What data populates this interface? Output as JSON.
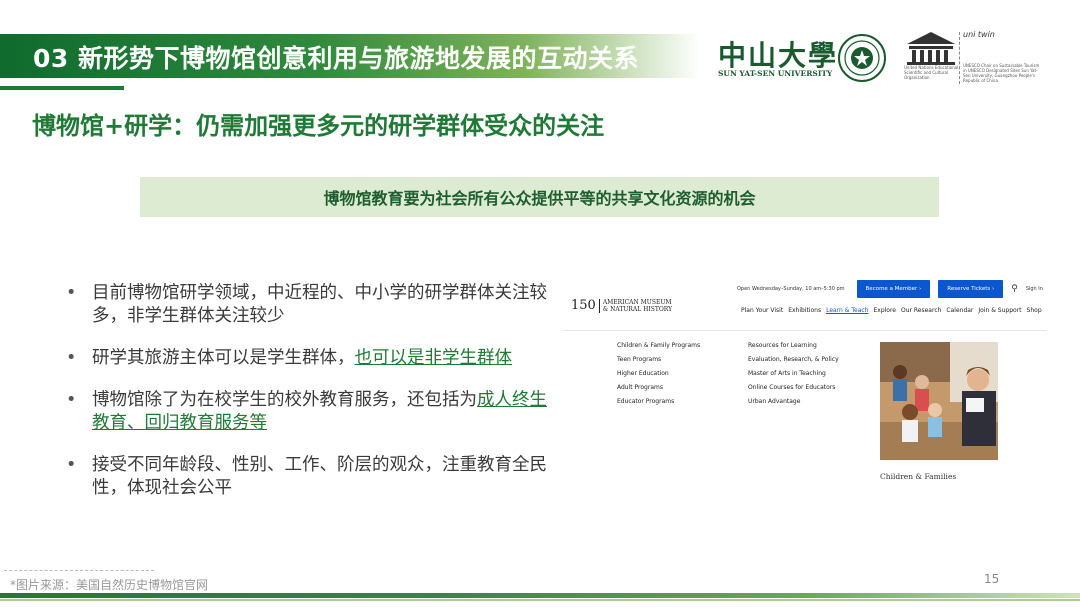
{
  "header": {
    "title": "03 新形势下博物馆创意利用与旅游地发展的互动关系"
  },
  "logos": {
    "sysu_cn": "中山大學",
    "sysu_en": "SUN YAT-SEN UNIVERSITY",
    "unesco_text": "United Nations Educational, Scientific and Cultural Organization",
    "unitwin_label": "uni twin",
    "unitwin_text": "UNESCO Chair on Sustainable Tourism in UNESCO Designated Sites Sun Yat-Sen University, Guangzhou People's Republic of China"
  },
  "subtitle": "博物馆+研学：仍需加强更多元的研学群体受众的关注",
  "banner": "博物馆教育要为社会所有公众提供平等的共享文化资源的机会",
  "bullets": [
    {
      "text": "目前博物馆研学领域，中近程的、中小学的研学群体关注较多，非学生群体关注较少",
      "highlight": ""
    },
    {
      "text": "研学其旅游主体可以是学生群体，",
      "highlight": "也可以是非学生群体"
    },
    {
      "text": "博物馆除了为在校学生的校外教育服务，还包括为",
      "highlight": "成人终生教育、回归教育服务等"
    },
    {
      "text": "接受不同年龄段、性别、工作、阶层的观众，注重教育全民性，体现社会公平",
      "highlight": ""
    }
  ],
  "site": {
    "hours": "Open Wednesday–Sunday, 10 am–5:30 pm",
    "member_button": "Become a Member ›",
    "tickets_button": "Reserve Tickets ›",
    "search_icon": "search-icon",
    "signin": "Sign In",
    "logo_150": "150",
    "museum_line1": "AMERICAN MUSEUM",
    "museum_line2": "& NATURAL HISTORY",
    "nav": [
      "Plan Your Visit",
      "Exhibitions",
      "Learn & Teach",
      "Explore",
      "Our Research",
      "Calendar",
      "Join & Support",
      "Shop"
    ],
    "nav_active_index": 2,
    "col1": [
      "Children & Family Programs",
      "Teen Programs",
      "Higher Education",
      "Adult Programs",
      "Educator Programs"
    ],
    "col2": [
      "Resources for Learning",
      "Evaluation, Research, & Policy",
      "Master of Arts in Teaching",
      "Online Courses for Educators",
      "Urban Advantage"
    ],
    "caption": "Children & Families"
  },
  "footer": {
    "source": "*图片来源：美国自然历史博物馆官网",
    "page": "15"
  },
  "colors": {
    "accent_green": "#1f7a35",
    "banner_bg": "#dcebd2",
    "site_blue": "#0b57d0"
  }
}
